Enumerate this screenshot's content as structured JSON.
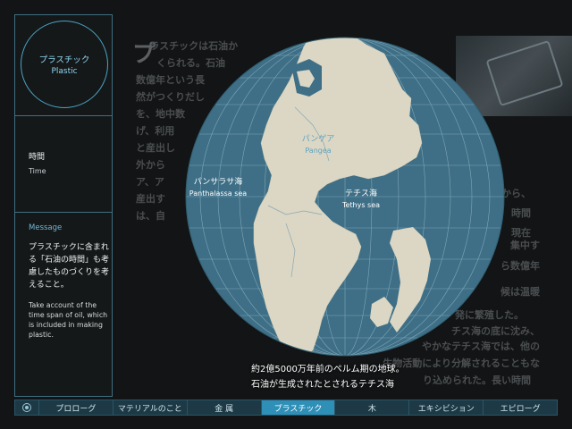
{
  "panel": {
    "title_jp": "プラスチック",
    "title_en": "Plastic",
    "time_jp": "時間",
    "time_en": "Time",
    "message_title": "Message",
    "message_jp": "プラスチックに含まれる「石油の時間」も考慮したものづくりを考えること。",
    "message_en": "Take account of the time span of oil, which is included in making plastic."
  },
  "background": {
    "title_glyph": "プ",
    "text": "    ラスチックは石油か\n      くられる。石油\n数億年という長\n然がつくりだし\nを、地中数\nげ、利用\nと産出し\n外から\nア、ア\n産出す\nは、自\n\n\n\n\n\n\n"
  },
  "map": {
    "pangea_jp": "パンゲア",
    "pangea_en": "Pangea",
    "panthalassa_jp": "パンサラサ海",
    "panthalassa_en": "Panthalassa sea",
    "tethys_jp": "テチス海",
    "tethys_en": "Tethys sea",
    "ocean_color": "#3e6f86",
    "land_color": "#dbd7c4"
  },
  "caption": {
    "line1": "約2億5000万年前のペルム期の地球。",
    "line2": "石油が生成されたとされるテチス海"
  },
  "right_text": {
    "lines": [
      "から、",
      "時間",
      "現在",
      "集中す",
      "ら数億年",
      "候は温暖",
      "発に繁殖した。",
      "チス海の底に沈み、",
      "やかなテチス海では、他の",
      "生物活動により分解されることもな",
      "り込められた。長い時間"
    ]
  },
  "nav": {
    "items": [
      "プロローグ",
      "マテリアルのこと",
      "金 属",
      "プラスチック",
      "木",
      "エキシビション",
      "エピローグ"
    ],
    "active_index": 3
  }
}
